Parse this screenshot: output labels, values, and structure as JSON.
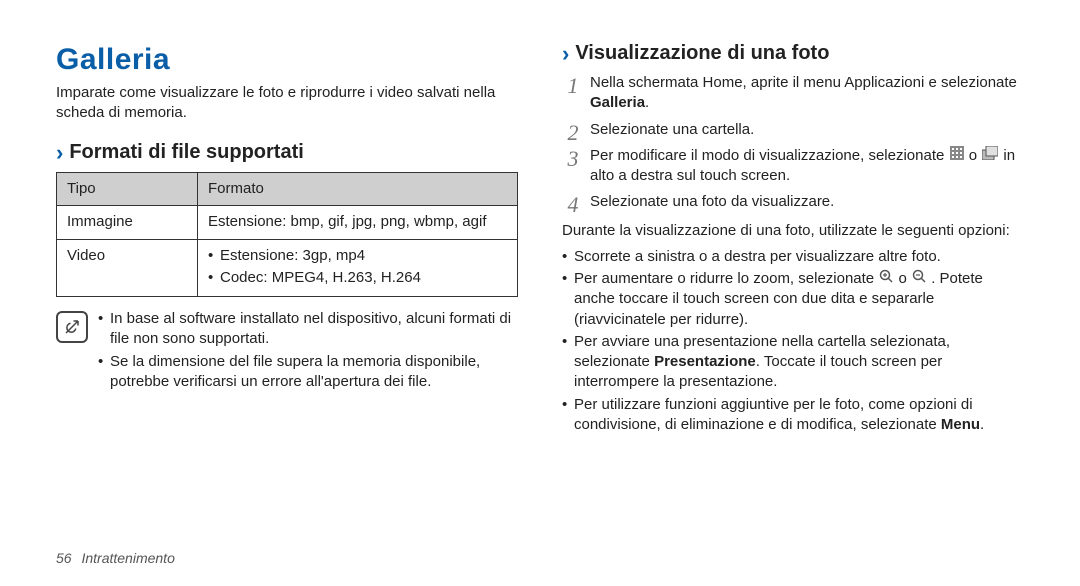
{
  "left": {
    "title": "Galleria",
    "intro": "Imparate come visualizzare le foto e riprodurre i video salvati nella scheda di memoria.",
    "sub1": "Formati di file supportati",
    "table": {
      "h_tipo": "Tipo",
      "h_formato": "Formato",
      "r1_tipo": "Immagine",
      "r1_fmt": "Estensione: bmp, gif, jpg, png, wbmp, agif",
      "r2_tipo": "Video",
      "r2_b1": "Estensione: 3gp, mp4",
      "r2_b2": "Codec: MPEG4, H.263, H.264"
    },
    "note1": "In base al software installato nel dispositivo, alcuni formati di file non sono supportati.",
    "note2": "Se la dimensione del file supera la memoria disponibile, potrebbe verificarsi un errore all'apertura dei file."
  },
  "right": {
    "sub1": "Visualizzazione di una foto",
    "s1a": "Nella schermata Home, aprite il menu Applicazioni e selezionate ",
    "s1b": "Galleria",
    "s1c": ".",
    "s2": "Selezionate una cartella.",
    "s3a": "Per modificare il modo di visualizzazione, selezionate ",
    "s3b": " o ",
    "s3c": " in alto a destra sul touch screen.",
    "s4": "Selezionate una foto da visualizzare.",
    "during": "Durante la visualizzazione di una foto, utilizzate le seguenti opzioni:",
    "b1": "Scorrete a sinistra o a destra per visualizzare altre foto.",
    "b2a": "Per aumentare o ridurre lo zoom, selezionate ",
    "b2b": " o ",
    "b2c": ". Potete anche toccare il touch screen con due dita e separarle (riavvicinatele per ridurre).",
    "b3a": "Per avviare una presentazione nella cartella selezionata, selezionate ",
    "b3b": "Presentazione",
    "b3c": ". Toccate il touch screen per interrompere la presentazione.",
    "b4a": "Per utilizzare funzioni aggiuntive per le foto, come opzioni di condivisione, di eliminazione e di modifica, selezionate ",
    "b4b": "Menu",
    "b4c": "."
  },
  "footer": {
    "page": "56",
    "section": "Intrattenimento"
  },
  "nums": {
    "n1": "1",
    "n2": "2",
    "n3": "3",
    "n4": "4"
  }
}
